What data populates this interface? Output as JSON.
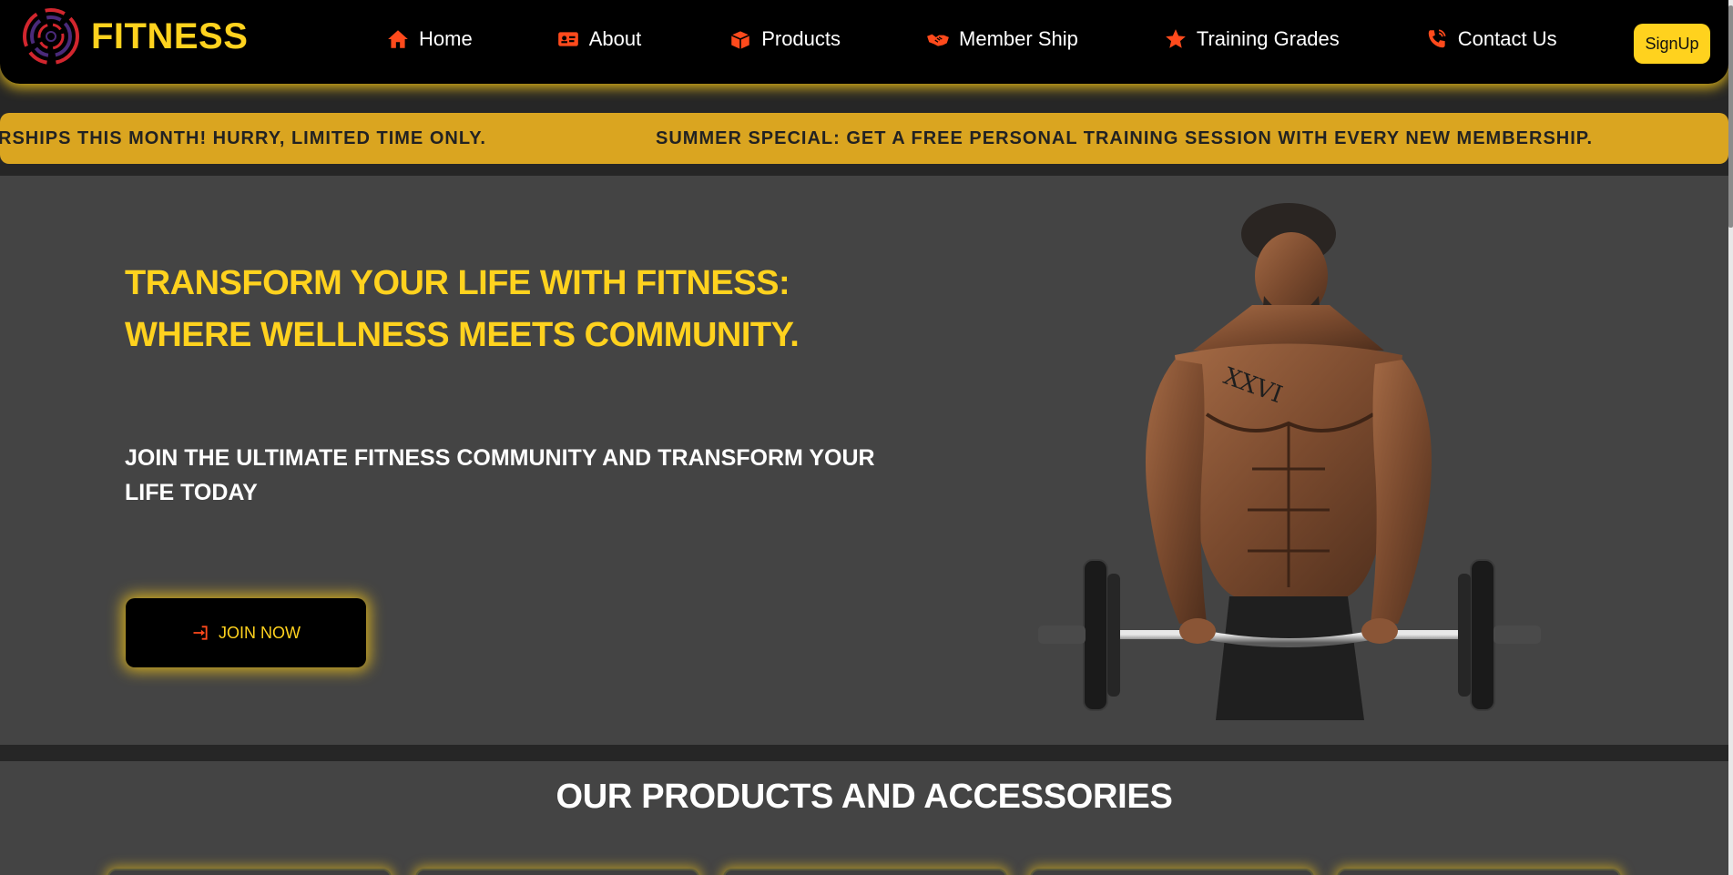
{
  "nav": {
    "brand": "FITNESS",
    "links": [
      {
        "label": "Home",
        "icon": "home-icon"
      },
      {
        "label": "About",
        "icon": "id-card-icon"
      },
      {
        "label": "Products",
        "icon": "box-icon"
      },
      {
        "label": "Member Ship",
        "icon": "handshake-icon"
      },
      {
        "label": "Training Grades",
        "icon": "star-icon"
      },
      {
        "label": "Contact Us",
        "icon": "phone-icon"
      }
    ],
    "signup_label": "SignUp"
  },
  "ticker": {
    "message_1": "RSHIPS THIS MONTH! HURRY, LIMITED TIME ONLY.",
    "message_2": "SUMMER SPECIAL: GET A FREE PERSONAL TRAINING SESSION WITH EVERY NEW MEMBERSHIP."
  },
  "hero": {
    "title_line_1": "TRANSFORM YOUR LIFE WITH FITNESS:",
    "title_line_2": "WHERE WELLNESS MEETS COMMUNITY.",
    "subtitle": "JOIN THE ULTIMATE FITNESS COMMUNITY AND TRANSFORM YOUR LIFE TODAY",
    "cta_label": "JOIN NOW"
  },
  "products": {
    "heading": "OUR PRODUCTS AND ACCESSORIES"
  },
  "colors": {
    "accent_yellow": "#ffd21e",
    "ticker_gold": "#daa520",
    "icon_orange": "#ff4a1c",
    "hero_bg": "#444444"
  }
}
